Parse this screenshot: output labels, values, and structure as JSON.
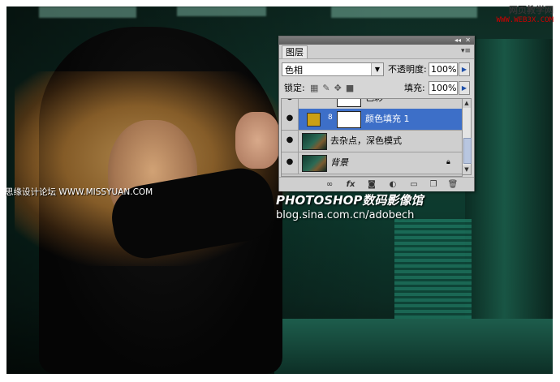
{
  "watermark": {
    "site_name": "网页教学网",
    "site_url": "WWW.WEB3X.COM",
    "left_text": "思缘设计论坛 WWW.MISSYUAN.COM",
    "brand_title": "PHOTOSHOP数码影像馆",
    "brand_url": "blog.sina.com.cn/adobech"
  },
  "panel": {
    "tab_label": "图层",
    "collapse_glyph": "◂◂",
    "close_glyph": "✕",
    "menu_glyph": "▾≡",
    "blend_mode": "色相",
    "opacity_label": "不透明度:",
    "opacity_value": "100%",
    "lock_label": "锁定:",
    "fill_label": "填充:",
    "fill_value": "100%",
    "layers": [
      {
        "name": "色彩",
        "type": "adjustment",
        "selected": false,
        "partial": true
      },
      {
        "name": "颜色填充 1",
        "type": "fill",
        "selected": true,
        "swatch_color": "#caa015"
      },
      {
        "name": "去杂点，深色模式",
        "type": "image",
        "selected": false
      },
      {
        "name": "背景",
        "type": "background",
        "selected": false,
        "locked": true
      }
    ],
    "bottom_icons": [
      "link-icon",
      "fx-icon",
      "mask-icon",
      "adjustment-icon",
      "folder-icon",
      "new-layer-icon",
      "trash-icon"
    ]
  },
  "colors": {
    "selection": "#3d6fc8",
    "fill_swatch": "#caa015"
  }
}
